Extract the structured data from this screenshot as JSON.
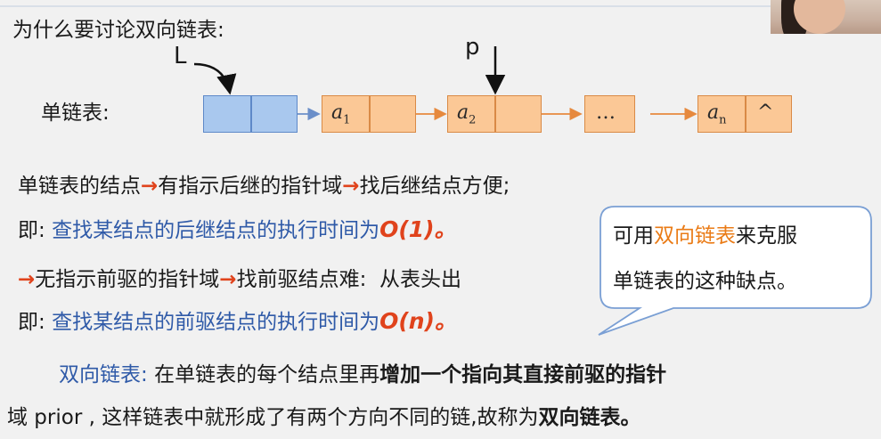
{
  "title": "为什么要讨论双向链表:",
  "diagram": {
    "head_label": "L",
    "pointer_label": "p",
    "list_label": "单链表:",
    "nodes": [
      {
        "data": "a",
        "sub": "1"
      },
      {
        "data": "a",
        "sub": "2"
      },
      {
        "data": "…",
        "sub": ""
      },
      {
        "data": "a",
        "sub": "n",
        "next": "^"
      }
    ]
  },
  "line1": {
    "p1": "单链表的结点",
    "arrow": "→",
    "p2": "有指示后继的指针域",
    "p3": "找后继结点方便;"
  },
  "line2": {
    "prefix": "即:",
    "text": "查找某结点的后继结点的执行时间为",
    "complexity": "O(1)。"
  },
  "line3": {
    "p1": "无指示前驱的指针域",
    "p2": "找前驱结点难:",
    "p3": "从表头出"
  },
  "line4": {
    "prefix": "即:",
    "text": "查找某结点的前驱结点的执行时间为",
    "complexity": "O(n)。"
  },
  "bubble": {
    "part1": "可用",
    "highlight": "双向链表",
    "part2": "来克服",
    "line2": "单链表的这种缺点。"
  },
  "para": {
    "term": "双向链表:",
    "t1": "在单链表的每个结点里再",
    "b1": "增加一个指向其直接前驱的指针",
    "t2": "域 prior , 这样链表中就形成了有两个方向不同的链,故称为",
    "b2": "双向链表。"
  },
  "colors": {
    "node_fill": "#fbc896",
    "head_fill": "#a9c8ee",
    "accent_blue": "#2f5aa8",
    "accent_red": "#e0431c",
    "accent_orange": "#ea7b16"
  }
}
